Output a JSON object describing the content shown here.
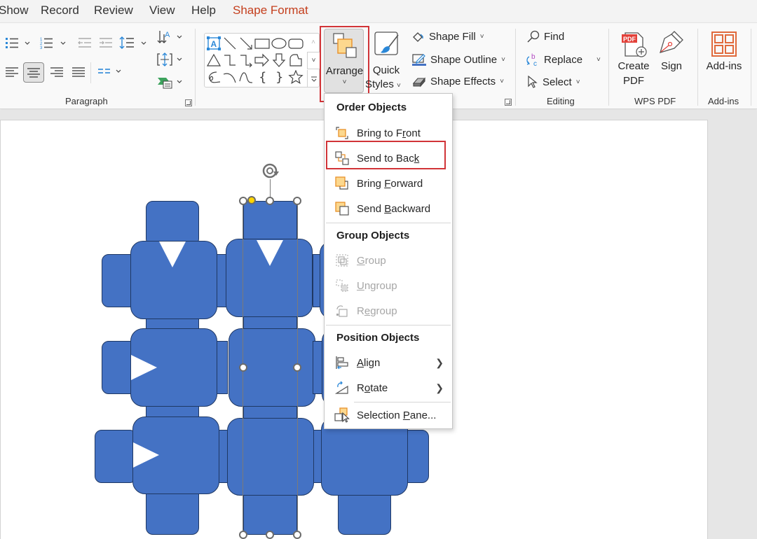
{
  "tabs": [
    {
      "label": "Show",
      "active": false
    },
    {
      "label": "Record",
      "active": false
    },
    {
      "label": "Review",
      "active": false
    },
    {
      "label": "View",
      "active": false
    },
    {
      "label": "Help",
      "active": false
    },
    {
      "label": "Shape Format",
      "active": true
    }
  ],
  "ribbon": {
    "paragraph": {
      "group_label": "Paragraph",
      "buttons": [
        "bullets",
        "numbering",
        "decrease-indent",
        "increase-indent",
        "line-spacing",
        "align-left",
        "align-center",
        "align-right",
        "justify",
        "columns",
        "text-direction",
        "align-text",
        "convert-to-smartart"
      ],
      "selected_alignment": "align-center"
    },
    "drawing": {
      "gallery_shapes": [
        "text-box",
        "line",
        "arrow-line",
        "rectangle",
        "oval",
        "rounded-rectangle",
        "triangle",
        "elbow-connector",
        "elbow-arrow-connector",
        "right-arrow",
        "down-arrow",
        "flowchart-shape",
        "freeform-scribble",
        "arc",
        "curve",
        "left-brace",
        "right-brace",
        "star"
      ],
      "arrange_label": "Arrange",
      "quick_styles_label": "Quick",
      "quick_styles_label2": "Styles",
      "shape_fill": "Shape Fill",
      "shape_outline": "Shape Outline",
      "shape_effects": "Shape Effects"
    },
    "editing": {
      "group_label": "Editing",
      "find": "Find",
      "replace": "Replace",
      "select": "Select"
    },
    "wps_pdf": {
      "group_label": "WPS PDF",
      "create_pdf_1": "Create",
      "create_pdf_2": "PDF",
      "pdf_badge": "PDF",
      "sign": "Sign"
    },
    "addins": {
      "group_label": "Add-ins",
      "button": "Add-ins"
    }
  },
  "menu": {
    "sections": [
      {
        "heading": "Order Objects"
      },
      {
        "heading": "Group Objects"
      },
      {
        "heading": "Position Objects"
      }
    ],
    "items": {
      "bring_to_front": {
        "pre": "Bring to F",
        "u": "r",
        "post": "ont",
        "enabled": true
      },
      "send_to_back": {
        "pre": "Send to Bac",
        "u": "k",
        "post": "",
        "enabled": true,
        "highlighted": true
      },
      "bring_forward": {
        "pre": "Bring ",
        "u": "F",
        "post": "orward",
        "enabled": true
      },
      "send_backward": {
        "pre": "Send ",
        "u": "B",
        "post": "ackward",
        "enabled": true
      },
      "group": {
        "pre": "",
        "u": "G",
        "post": "roup",
        "enabled": false
      },
      "ungroup": {
        "pre": "",
        "u": "U",
        "post": "ngroup",
        "enabled": false
      },
      "regroup": {
        "pre": "R",
        "u": "e",
        "post": "group",
        "enabled": false
      },
      "align": {
        "pre": "",
        "u": "A",
        "post": "lign",
        "enabled": true,
        "submenu": true
      },
      "rotate": {
        "pre": "R",
        "u": "o",
        "post": "tate",
        "enabled": true,
        "submenu": true
      },
      "selection_pane": {
        "pre": "Selection ",
        "u": "P",
        "post": "ane...",
        "enabled": true
      }
    }
  },
  "colors": {
    "accent_tab": "#c43e1c",
    "highlight_box": "#d13438",
    "shape_fill": "#4472c4",
    "shape_outline": "#1f3864"
  }
}
